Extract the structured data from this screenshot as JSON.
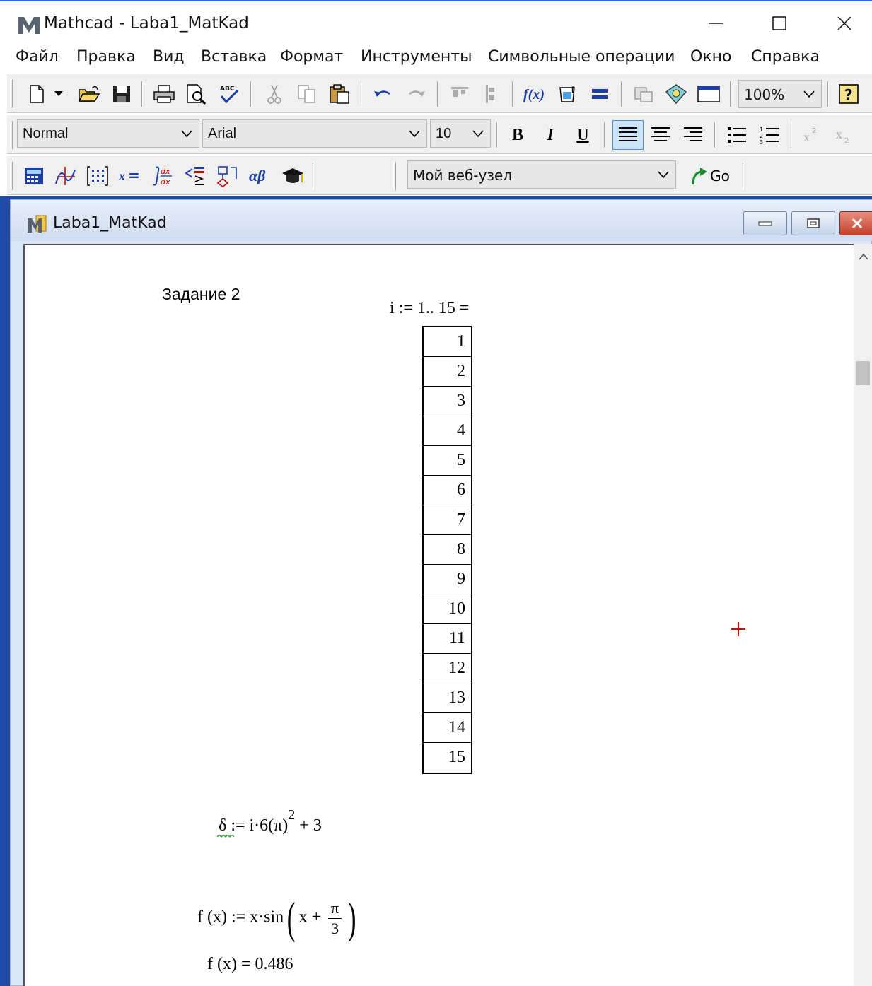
{
  "window": {
    "title": "Mathcad - Laba1_MatKad"
  },
  "menu": [
    "Файл",
    "Правка",
    "Вид",
    "Вставка",
    "Формат",
    "Инструменты",
    "Символьные операции",
    "Окно",
    "Справка"
  ],
  "toolbar": {
    "zoom": "100%",
    "style": "Normal",
    "font": "Arial",
    "font_size": "10",
    "bold_label": "B",
    "italic_label": "I",
    "underline_label": "U",
    "resource": "Мой веб-узел",
    "go_label": "Go"
  },
  "document": {
    "title": "Laba1_MatKad",
    "task_label": "Задание 2",
    "range_definition": "i := 1.. 15 =",
    "table_values": [
      "1",
      "2",
      "3",
      "4",
      "5",
      "6",
      "7",
      "8",
      "9",
      "10",
      "11",
      "12",
      "13",
      "14",
      "15"
    ],
    "delta_lhs": "δ",
    "delta_rhs": ":= i·6(π)",
    "delta_exp": "2",
    "delta_tail": " + 3",
    "func_lhs": "f (x)  := x·sin",
    "func_inner": "x + ",
    "func_num": "π",
    "func_den": "3",
    "func_eval": "f (x)  = 0.486"
  },
  "colors": {
    "accent": "#2b6fd6",
    "mdi_background": "#1e4aa6",
    "cursor": "#e00000"
  },
  "icons": [
    "new-icon",
    "open-icon",
    "save-icon",
    "print-icon",
    "preview-icon",
    "spellcheck-icon",
    "cut-icon",
    "copy-icon",
    "paste-icon",
    "undo-icon",
    "redo-icon",
    "align-top-icon",
    "align-down-icon",
    "insert-function-icon",
    "insert-unit-icon",
    "calculate-icon",
    "component-icon",
    "resource-center-icon",
    "table-icon",
    "help-icon"
  ]
}
